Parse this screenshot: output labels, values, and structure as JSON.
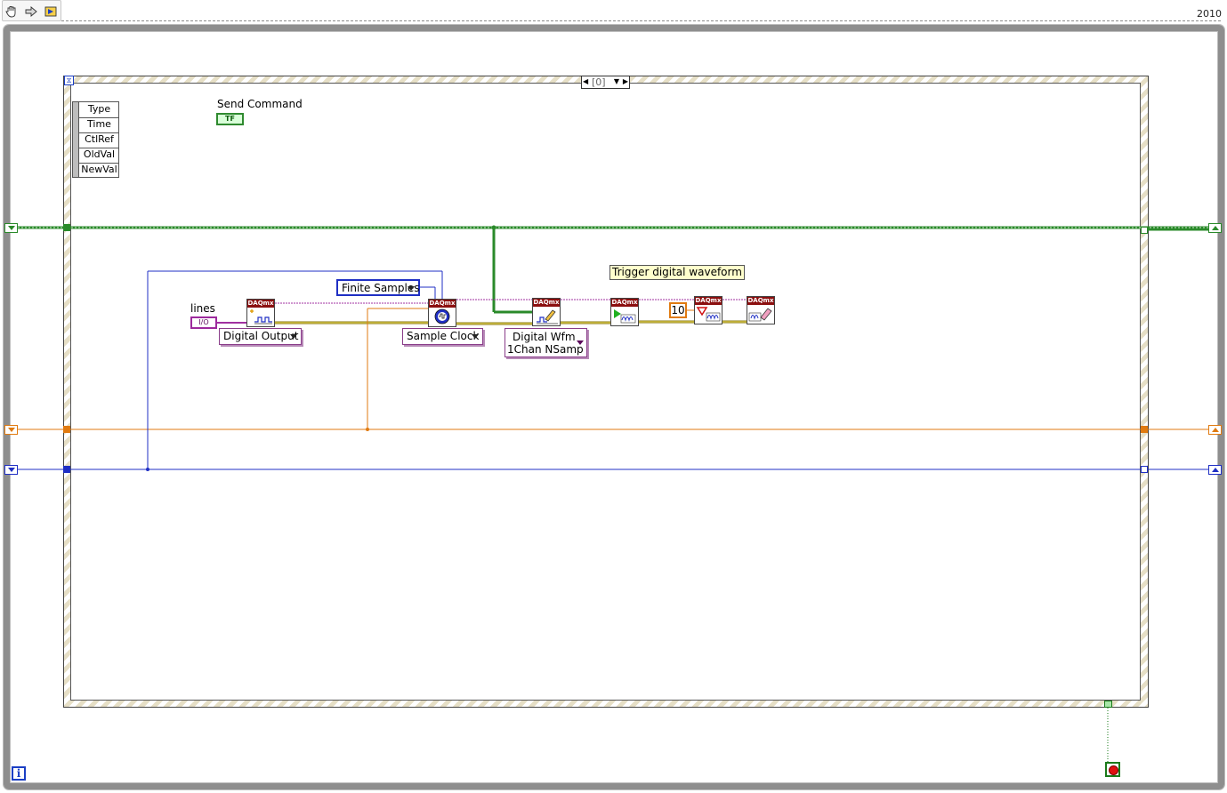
{
  "toolbar": {
    "tools": [
      "hand-icon",
      "arrow-icon",
      "probe-icon"
    ],
    "version": "2010"
  },
  "event_structure": {
    "case_label": "[0]",
    "event_data_fields": [
      "Type",
      "Time",
      "CtlRef",
      "OldVal",
      "NewVal"
    ]
  },
  "controls": {
    "send_command_label": "Send Command",
    "send_command_terminal": "TF",
    "lines_label": "lines",
    "lines_terminal": "I/O"
  },
  "constants": {
    "channel_type": "Digital Output",
    "sample_mode": "Finite Samples",
    "timing_type": "Sample Clock",
    "write_type_line1": "Digital Wfm",
    "write_type_line2": "1Chan NSamp",
    "timeout_value": "10"
  },
  "comment": "Trigger digital waveform",
  "vi_header": "DAQmx",
  "colors": {
    "task_wire": "#2a8a2a",
    "error_wire_a": "#e0a010",
    "string_wire": "#a030a0",
    "numeric_orange": "#e07a10",
    "numeric_blue": "#1f2fc4",
    "daq_header": "#8b0f0f"
  },
  "info_icon": "i"
}
